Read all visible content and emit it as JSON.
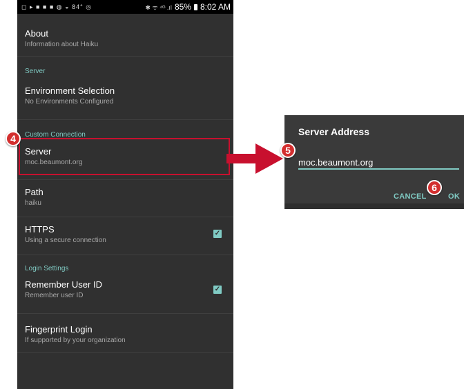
{
  "statusbar": {
    "left_icons": "◻ ▸ ■ ■ ■ ◍ ◒ 84° ◎",
    "signal": "✱ ᯤ ⁴ᴳ .ıl",
    "battery": "85%",
    "time": "8:02 AM"
  },
  "settings": {
    "about": {
      "title": "About",
      "summary": "Information about Haiku"
    },
    "server_category": "Server",
    "environment": {
      "title": "Environment Selection",
      "summary": "No Environments Configured"
    },
    "custom_category": "Custom Connection",
    "server": {
      "title": "Server",
      "summary": "moc.beaumont.org"
    },
    "path": {
      "title": "Path",
      "summary": "haiku"
    },
    "https": {
      "title": "HTTPS",
      "summary": "Using a secure connection",
      "checked": true
    },
    "login_category": "Login Settings",
    "remember": {
      "title": "Remember User ID",
      "summary": "Remember user ID",
      "checked": true
    },
    "fingerprint": {
      "title": "Fingerprint Login",
      "summary": "If supported by your organization"
    }
  },
  "dialog": {
    "title": "Server Address",
    "input_value": "moc.beaumont.org",
    "cancel_label": "CANCEL",
    "ok_label": "OK"
  },
  "annotations": {
    "step4": "4",
    "step5": "5",
    "step6": "6"
  },
  "colors": {
    "accent": "#80cbc4",
    "highlight": "#c8102e",
    "badge": "#d32f2f",
    "background": "#303030"
  }
}
